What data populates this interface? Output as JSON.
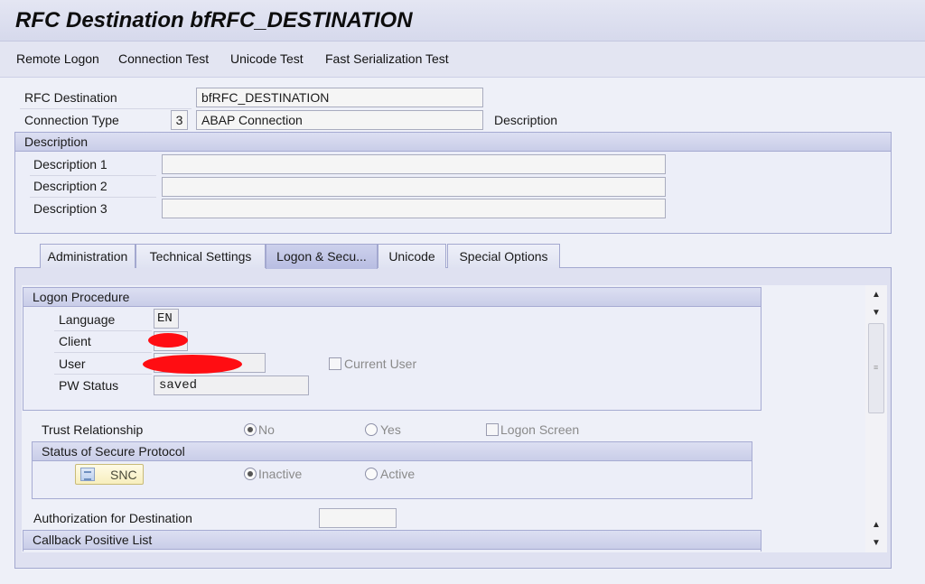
{
  "window": {
    "title": "RFC Destination bfRFC_DESTINATION"
  },
  "toolbar": {
    "remote_logon": "Remote Logon",
    "connection_test": "Connection Test",
    "unicode_test": "Unicode Test",
    "fast_serialization_test": "Fast Serialization Test"
  },
  "header": {
    "rfc_destination_label": "RFC Destination",
    "rfc_destination_value": "bfRFC_DESTINATION",
    "connection_type_label": "Connection Type",
    "connection_type_code": "3",
    "connection_type_value": "ABAP Connection",
    "description_label": "Description"
  },
  "description_group": {
    "title": "Description",
    "rows": [
      {
        "label": "Description 1",
        "value": ""
      },
      {
        "label": "Description 2",
        "value": ""
      },
      {
        "label": "Description 3",
        "value": ""
      }
    ]
  },
  "tabs": [
    {
      "label": "Administration",
      "active": false
    },
    {
      "label": "Technical Settings",
      "active": false
    },
    {
      "label": "Logon & Secu...",
      "active": true
    },
    {
      "label": "Unicode",
      "active": false
    },
    {
      "label": "Special Options",
      "active": false
    }
  ],
  "logon_procedure": {
    "title": "Logon Procedure",
    "language_label": "Language",
    "language_value": "EN",
    "client_label": "Client",
    "client_value": "",
    "user_label": "User",
    "user_value": "",
    "current_user_label": "Current User",
    "current_user_checked": false,
    "pw_status_label": "PW Status",
    "pw_status_value": "saved"
  },
  "trust_relationship": {
    "label": "Trust Relationship",
    "no_label": "No",
    "yes_label": "Yes",
    "selected": "No",
    "logon_screen_label": "Logon Screen",
    "logon_screen_checked": false
  },
  "secure_protocol": {
    "title": "Status of Secure Protocol",
    "snc_button": "SNC",
    "inactive_label": "Inactive",
    "active_label": "Active",
    "selected": "Inactive"
  },
  "authorization": {
    "label": "Authorization for Destination",
    "value": ""
  },
  "callback": {
    "title": "Callback Positive List"
  },
  "colors": {
    "redaction": "#ff0d12",
    "group_header": "#c9cde8",
    "active_tab": "#b8bde2"
  }
}
